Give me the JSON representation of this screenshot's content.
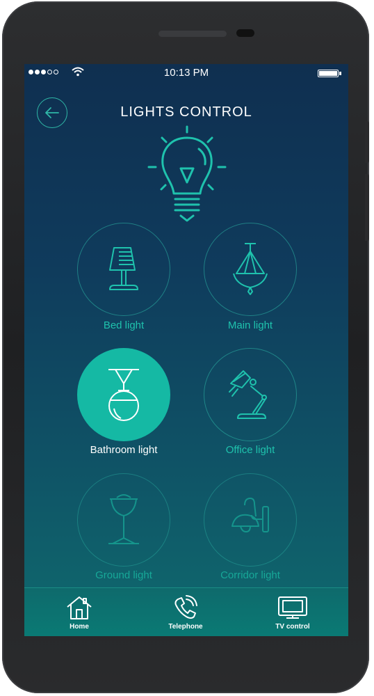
{
  "status": {
    "time": "10:13 PM",
    "signal_bars": 3,
    "signal_total": 5,
    "battery_level": 1.0
  },
  "header": {
    "title": "LIGHTS CONTROL",
    "back_icon": "arrow-left-icon"
  },
  "hero_icon": "lightbulb-icon",
  "lights": [
    {
      "label": "Bed light",
      "icon": "table-lamp-icon",
      "active": false
    },
    {
      "label": "Main light",
      "icon": "chandelier-icon",
      "active": false
    },
    {
      "label": "Bathroom light",
      "icon": "pendant-lamp-icon",
      "active": true
    },
    {
      "label": "Office light",
      "icon": "desk-lamp-icon",
      "active": false
    },
    {
      "label": "Ground light",
      "icon": "floor-lamp-icon",
      "active": false
    },
    {
      "label": "Corridor light",
      "icon": "wall-lamp-icon",
      "active": false
    }
  ],
  "tabs": [
    {
      "label": "Home",
      "icon": "home-icon"
    },
    {
      "label": "Telephone",
      "icon": "telephone-icon"
    },
    {
      "label": "TV control",
      "icon": "tv-icon"
    }
  ],
  "colors": {
    "accent": "#15b9a4",
    "label": "#1fc2ad",
    "screen_top": "#0f2f50",
    "screen_bottom": "#0f6a6e"
  }
}
